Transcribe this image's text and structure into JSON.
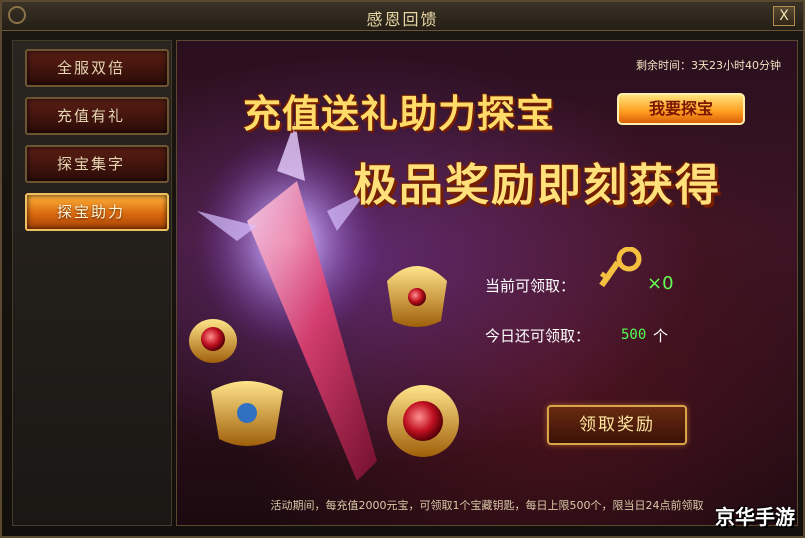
{
  "window": {
    "title": "感恩回馈",
    "close_label": "X"
  },
  "sidebar": {
    "items": [
      {
        "label": "全服双倍",
        "active": false
      },
      {
        "label": "充值有礼",
        "active": false
      },
      {
        "label": "探宝集字",
        "active": false
      },
      {
        "label": "探宝助力",
        "active": true
      }
    ]
  },
  "banner": {
    "remaining_time": "剩余时间：3天23小时40分钟",
    "headline_1": "充值送礼助力探宝",
    "headline_2": "极品奖励即刻获得",
    "explore_button": "我要探宝"
  },
  "rewards": {
    "claimable_label": "当前可领取：",
    "key_count": "×0",
    "today_label": "今日还可领取：",
    "today_value": "500",
    "today_unit": "个",
    "claim_button": "领取奖励"
  },
  "footer": {
    "note": "活动期间，每充值2000元宝，可领取1个宝藏钥匙，每日上限500个，限当日24点前领取"
  },
  "watermark": "京华手游",
  "colors": {
    "accent": "#ffdc6a",
    "active_tab": "#ff9c1e",
    "count_green": "#66ff55"
  }
}
